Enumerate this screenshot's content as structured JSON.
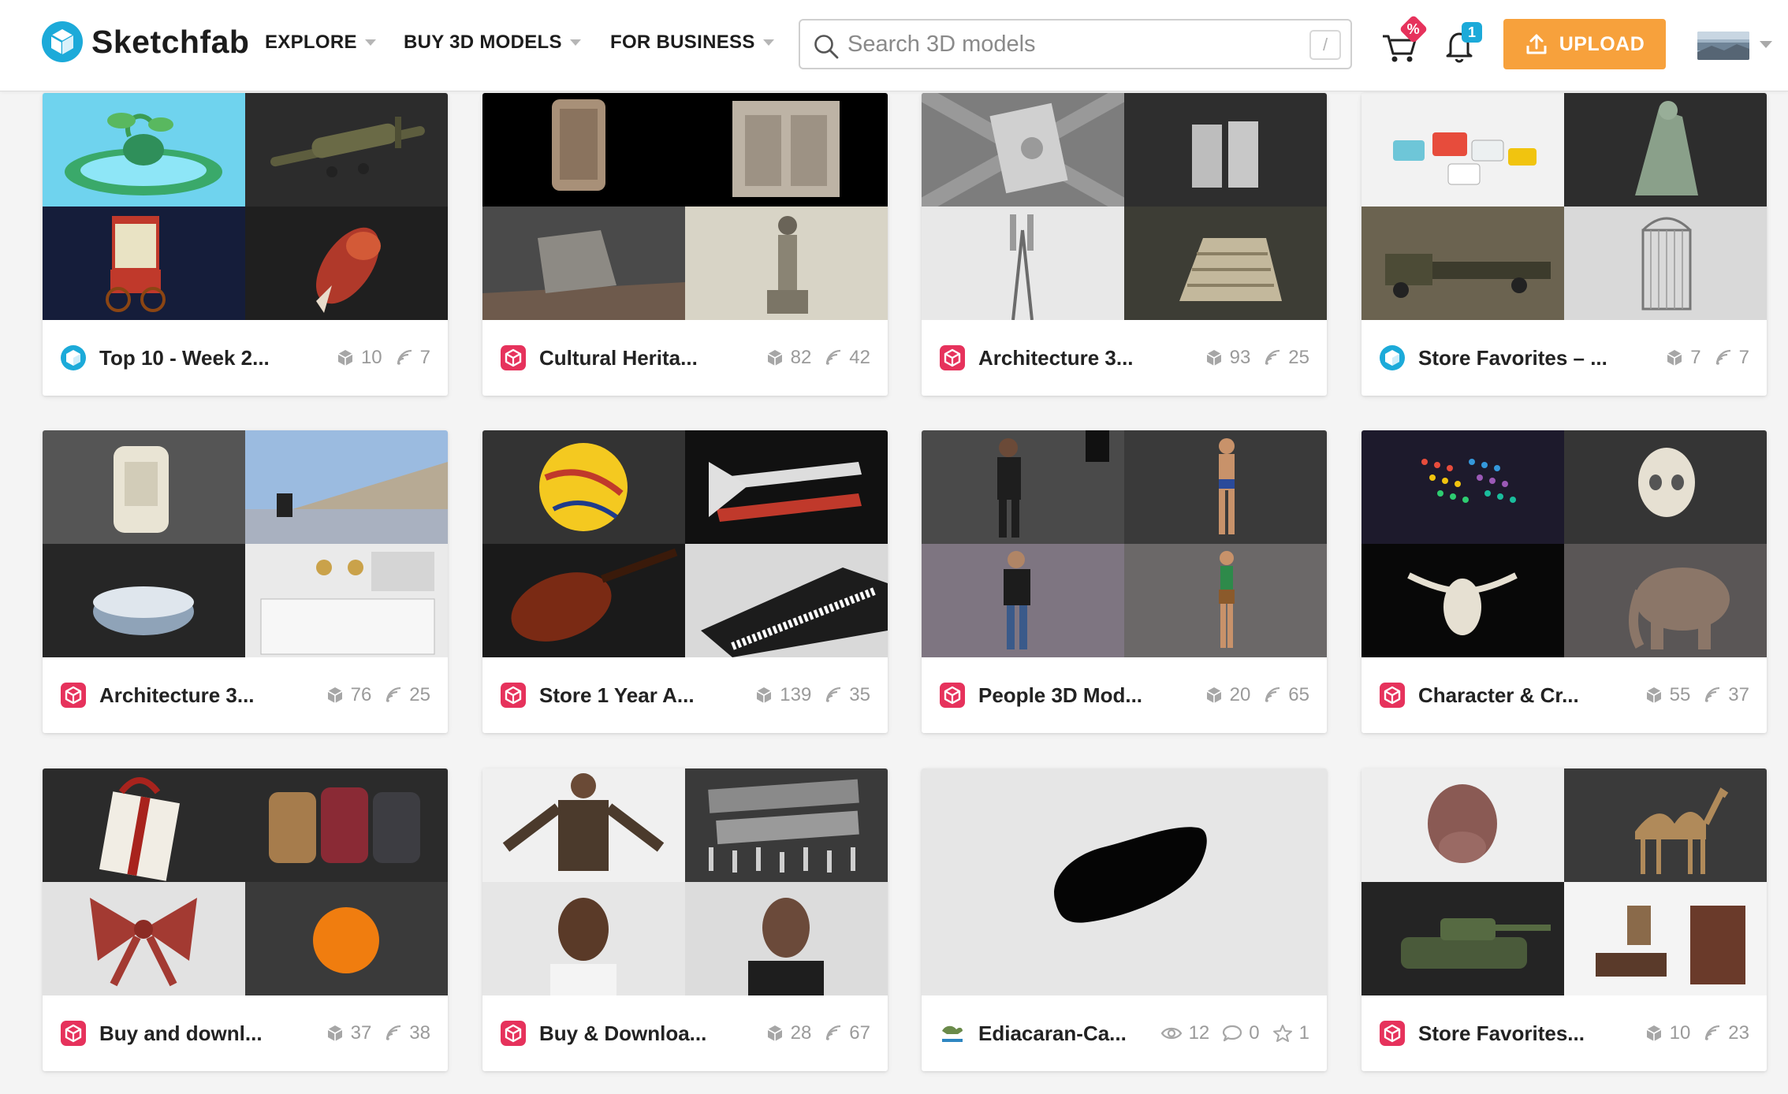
{
  "brand": {
    "name": "Sketchfab",
    "accent": "#1caad9",
    "upload_color": "#f7a13c",
    "collection_color": "#e6325c"
  },
  "nav": {
    "explore": "EXPLORE",
    "buy": "BUY 3D MODELS",
    "business": "FOR BUSINESS"
  },
  "search": {
    "placeholder": "Search 3D models",
    "shortcut": "/"
  },
  "header_icons": {
    "cart": "cart-icon",
    "cart_badge": "%",
    "notifications": "bell-icon",
    "notification_badge": "1"
  },
  "upload": {
    "label": "UPLOAD"
  },
  "cards": [
    {
      "title": "Top 10 - Week 2...",
      "icon": "sketchfab-blue",
      "models": "10",
      "followers": "7"
    },
    {
      "title": "Cultural Herita...",
      "icon": "collection-red",
      "models": "82",
      "followers": "42"
    },
    {
      "title": "Architecture 3...",
      "icon": "collection-red",
      "models": "93",
      "followers": "25"
    },
    {
      "title": "Store Favorites – ...",
      "icon": "sketchfab-blue",
      "models": "7",
      "followers": "7"
    },
    {
      "title": "Architecture 3...",
      "icon": "collection-red",
      "models": "76",
      "followers": "25"
    },
    {
      "title": "Store 1 Year A...",
      "icon": "collection-red",
      "models": "139",
      "followers": "35"
    },
    {
      "title": "People 3D Mod...",
      "icon": "collection-red",
      "models": "20",
      "followers": "65"
    },
    {
      "title": "Character & Cr...",
      "icon": "collection-red",
      "models": "55",
      "followers": "37"
    },
    {
      "title": "Buy and downl...",
      "icon": "collection-red",
      "models": "37",
      "followers": "38"
    },
    {
      "title": "Buy & Downloa...",
      "icon": "collection-red",
      "models": "28",
      "followers": "67"
    },
    {
      "title": "Ediacaran-Ca...",
      "icon": "user-avatar",
      "views": "12",
      "comments": "0",
      "likes": "1"
    },
    {
      "title": "Store Favorites...",
      "icon": "collection-red",
      "models": "10",
      "followers": "23"
    }
  ]
}
